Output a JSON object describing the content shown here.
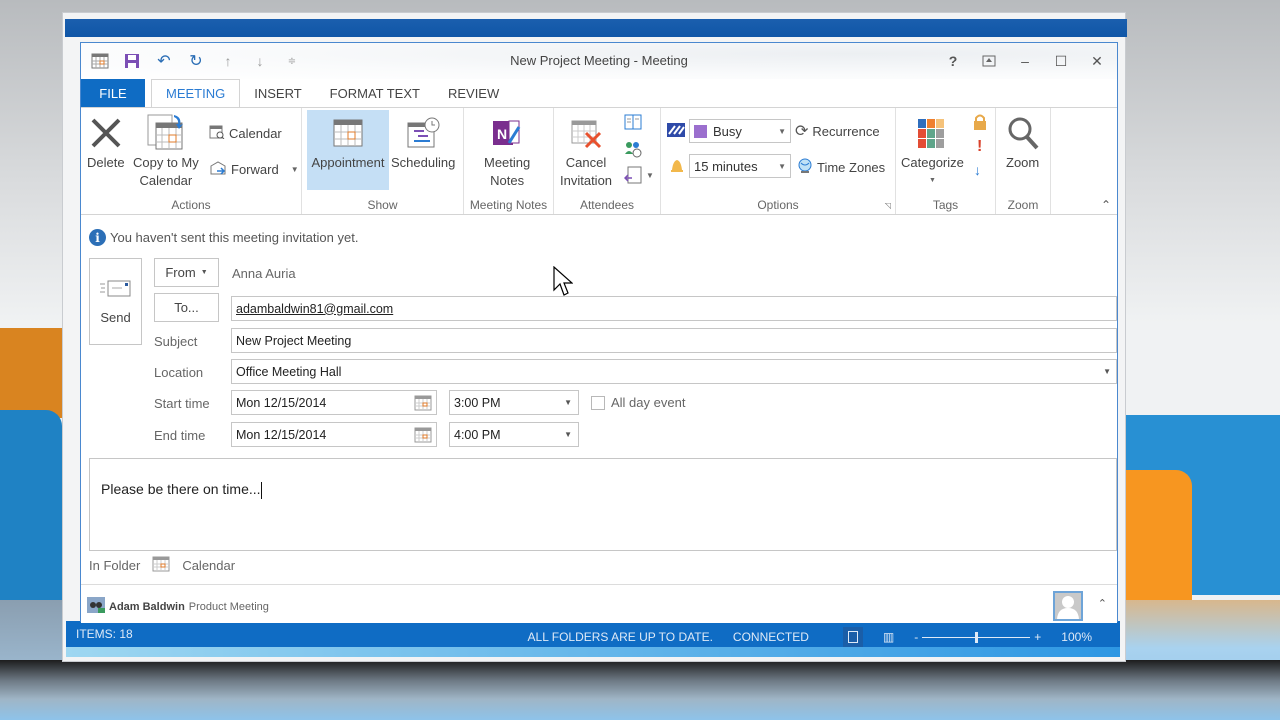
{
  "window": {
    "title": "New Project Meeting - Meeting",
    "controls": {
      "help": "?",
      "ribbon_display": "⇱",
      "minimize": "–",
      "maximize": "☐",
      "close": "✕"
    }
  },
  "quick_access": [
    "calendar-icon",
    "save-icon",
    "undo-icon",
    "redo-icon",
    "up-arrow-icon",
    "down-arrow-icon",
    "customize-icon"
  ],
  "tabs": [
    {
      "label": "FILE"
    },
    {
      "label": "MEETING",
      "active": true
    },
    {
      "label": "INSERT"
    },
    {
      "label": "FORMAT TEXT"
    },
    {
      "label": "REVIEW"
    }
  ],
  "ribbon": {
    "actions": {
      "label": "Actions",
      "delete": "Delete",
      "copy_line1": "Copy to My",
      "copy_line2": "Calendar",
      "calendar": "Calendar",
      "forward": "Forward"
    },
    "show": {
      "label": "Show",
      "appointment": "Appointment",
      "scheduling": "Scheduling"
    },
    "meeting_notes": {
      "label": "Meeting Notes",
      "line1": "Meeting",
      "line2": "Notes"
    },
    "attendees": {
      "label": "Attendees",
      "cancel_line1": "Cancel",
      "cancel_line2": "Invitation"
    },
    "options": {
      "label": "Options",
      "show_as": "Busy",
      "reminder": "15 minutes",
      "recurrence": "Recurrence",
      "time_zones": "Time Zones",
      "busy_color": "#9b6fce"
    },
    "tags": {
      "label": "Tags",
      "categorize": "Categorize"
    },
    "zoom": {
      "label": "Zoom",
      "zoom": "Zoom"
    }
  },
  "info_message": "You haven't sent this meeting invitation yet.",
  "form": {
    "send": "Send",
    "from_label": "From",
    "from_value": "Anna Auria",
    "to_label": "To...",
    "to_value": "adambaldwin81@gmail.com",
    "subject_label": "Subject",
    "subject_value": "New Project Meeting",
    "location_label": "Location",
    "location_value": "Office Meeting Hall",
    "start_label": "Start time",
    "start_date": "Mon 12/15/2014",
    "start_time": "3:00 PM",
    "all_day_label": "All day event",
    "all_day_checked": false,
    "end_label": "End time",
    "end_date": "Mon 12/15/2014",
    "end_time": "4:00 PM"
  },
  "body_text": "Please be there on time...",
  "folder": {
    "label": "In Folder",
    "value": "Calendar"
  },
  "people_pane": {
    "name": "Adam Baldwin",
    "subject": "Product Meeting"
  },
  "statusbar": {
    "items": "ITEMS: 18",
    "sync": "ALL FOLDERS ARE UP TO DATE.",
    "connection": "CONNECTED",
    "zoom_minus": "-",
    "zoom_plus": "+",
    "zoom_level": "100%",
    "zoom_fraction": 0.5
  },
  "colors": {
    "accent": "#0f6cc4",
    "tab_active": "#2b7cd3",
    "selected_button": "#c5dff5"
  }
}
